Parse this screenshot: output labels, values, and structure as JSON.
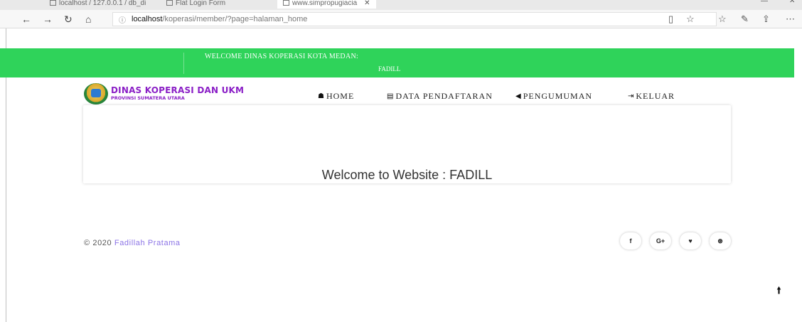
{
  "browser": {
    "tabs": [
      {
        "label": "localhost / 127.0.0.1 / db_di"
      },
      {
        "label": "Flat Login Form"
      },
      {
        "label": "www.simpropugiacia"
      }
    ],
    "address": {
      "host": "localhost",
      "path": "/koperasi/member/?page=halaman_home"
    }
  },
  "banner": {
    "line1": "WELCOME DINAS KOPERASI KOTA MEDAN:",
    "line2": "FADILL",
    "color": "#2fd35a"
  },
  "logo": {
    "title": "DINAS KOPERASI DAN UKM",
    "subtitle": "PROVINSI SUMATERA UTARA"
  },
  "menu": [
    {
      "label": "HOME",
      "icon": "home-icon"
    },
    {
      "label": "DATA PENDAFTARAN",
      "icon": "id-card-icon"
    },
    {
      "label": "PENGUMUMAN",
      "icon": "bullhorn-icon"
    },
    {
      "label": "KELUAR",
      "icon": "sign-out-icon"
    }
  ],
  "main": {
    "welcome_text": "Welcome to Website : FADILL"
  },
  "footer": {
    "copyright_prefix": "© 2020",
    "author": "Fadillah Pratama",
    "social": [
      {
        "icon": "facebook-icon",
        "glyph": "f"
      },
      {
        "icon": "google-plus-icon",
        "glyph": "G+"
      },
      {
        "icon": "twitter-icon",
        "glyph": "🐦"
      },
      {
        "icon": "dribbble-icon",
        "glyph": "⊛"
      }
    ]
  },
  "colors": {
    "accent_green": "#2fd35a",
    "logo_purple": "#8a1ec6",
    "link_purple": "#8b73e6"
  }
}
